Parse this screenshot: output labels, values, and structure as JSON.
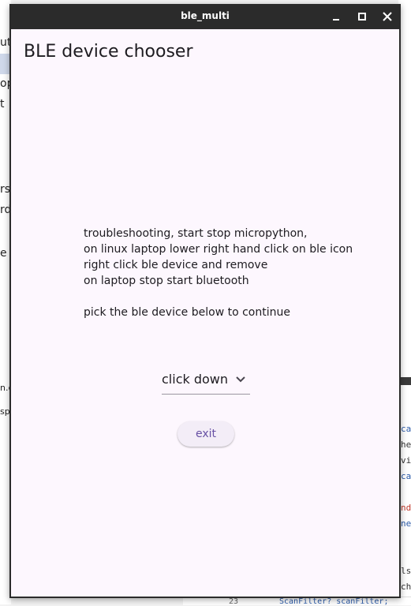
{
  "window": {
    "title": "ble_multi"
  },
  "app": {
    "title": "BLE device chooser",
    "instructions": [
      "troubleshooting, start stop micropython,",
      "on linux laptop lower right hand click on ble icon",
      "right click ble device and remove",
      "on laptop stop start bluetooth",
      "",
      "pick the ble device below to continue"
    ],
    "dropdown": {
      "selected": "click down"
    },
    "exit_label": "exit"
  },
  "background": {
    "left_fragments": [
      "ut",
      "op",
      "t",
      "rs",
      "rd",
      "e",
      "n.c",
      "sp"
    ],
    "right_fragments": [
      "cat",
      "her",
      "vic",
      "cat",
      "nds",
      "neu",
      "lsc",
      "cha"
    ],
    "line_number": "23",
    "code_line": "ScanFilter? scanFilter;"
  },
  "colors": {
    "titlebar": "#2b2b2b",
    "client_bg": "#fdf7fe",
    "button_text": "#6750a4"
  }
}
